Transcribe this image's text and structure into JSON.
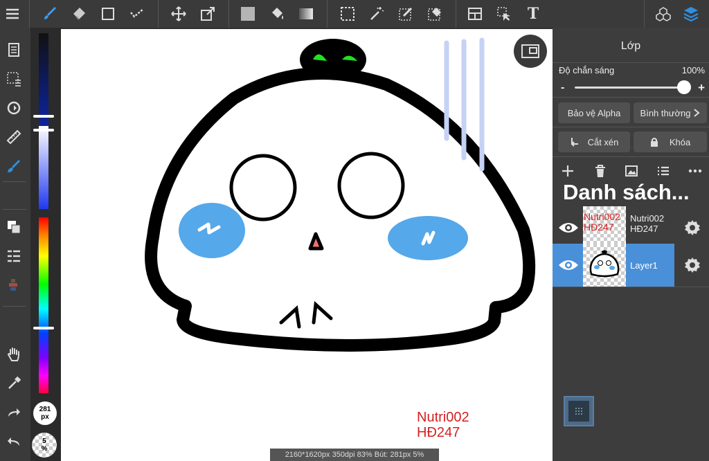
{
  "colors": {
    "accent": "#2f8fde",
    "selected_layer": "#4a90d9",
    "brush_color": "#2f8fde",
    "watermark": "#d42020"
  },
  "toolbar": {
    "icons": [
      "menu-icon",
      "brush-icon",
      "eraser-icon",
      "rectangle-icon",
      "smudge-icon",
      "move-icon",
      "transform-icon",
      "fill-color-icon",
      "bucket-icon",
      "gradient-icon",
      "select-icon",
      "magic-wand-icon",
      "select-pen-icon",
      "select-eraser-icon",
      "layout-icon",
      "select-layer-icon",
      "text-icon",
      "materials-icon",
      "layers-icon"
    ],
    "text_tool_label": "T"
  },
  "left_tools": [
    "pages-icon",
    "selection-icon",
    "rotate-icon",
    "ruler-icon",
    "brush-fill-icon",
    "layers-small-icon",
    "list-icon",
    "color-history-icon",
    "hand-icon",
    "eyedropper-icon",
    "redo-icon",
    "undo-icon"
  ],
  "brush": {
    "size_value": "281",
    "size_unit": "px",
    "opacity_value": "5",
    "opacity_unit": "%"
  },
  "canvas_watermark": {
    "line1": "Nutri002",
    "line2": "HĐ247"
  },
  "status_bar": "2160*1620px 350dpi 83% Bút: 281px 5%",
  "panel": {
    "title": "Lớp",
    "opacity_label": "Độ chắn sáng",
    "opacity_value": "100%",
    "opacity_level": 1.0,
    "minus": "-",
    "plus": "+",
    "alpha_protect": "Bảo vệ Alpha",
    "blend_mode": "Bình thường",
    "clip": "Cắt xén",
    "lock": "Khóa",
    "list_title": "Danh sách...",
    "layers": [
      {
        "name": "Nutri002\nHĐ247",
        "name_line1": "Nutri002",
        "name_line2": "HĐ247",
        "thumb_line1": "Nutri002",
        "thumb_line2": "HĐ247",
        "selected": false,
        "visible": true
      },
      {
        "name": "Layer1",
        "selected": true,
        "visible": true
      }
    ]
  }
}
